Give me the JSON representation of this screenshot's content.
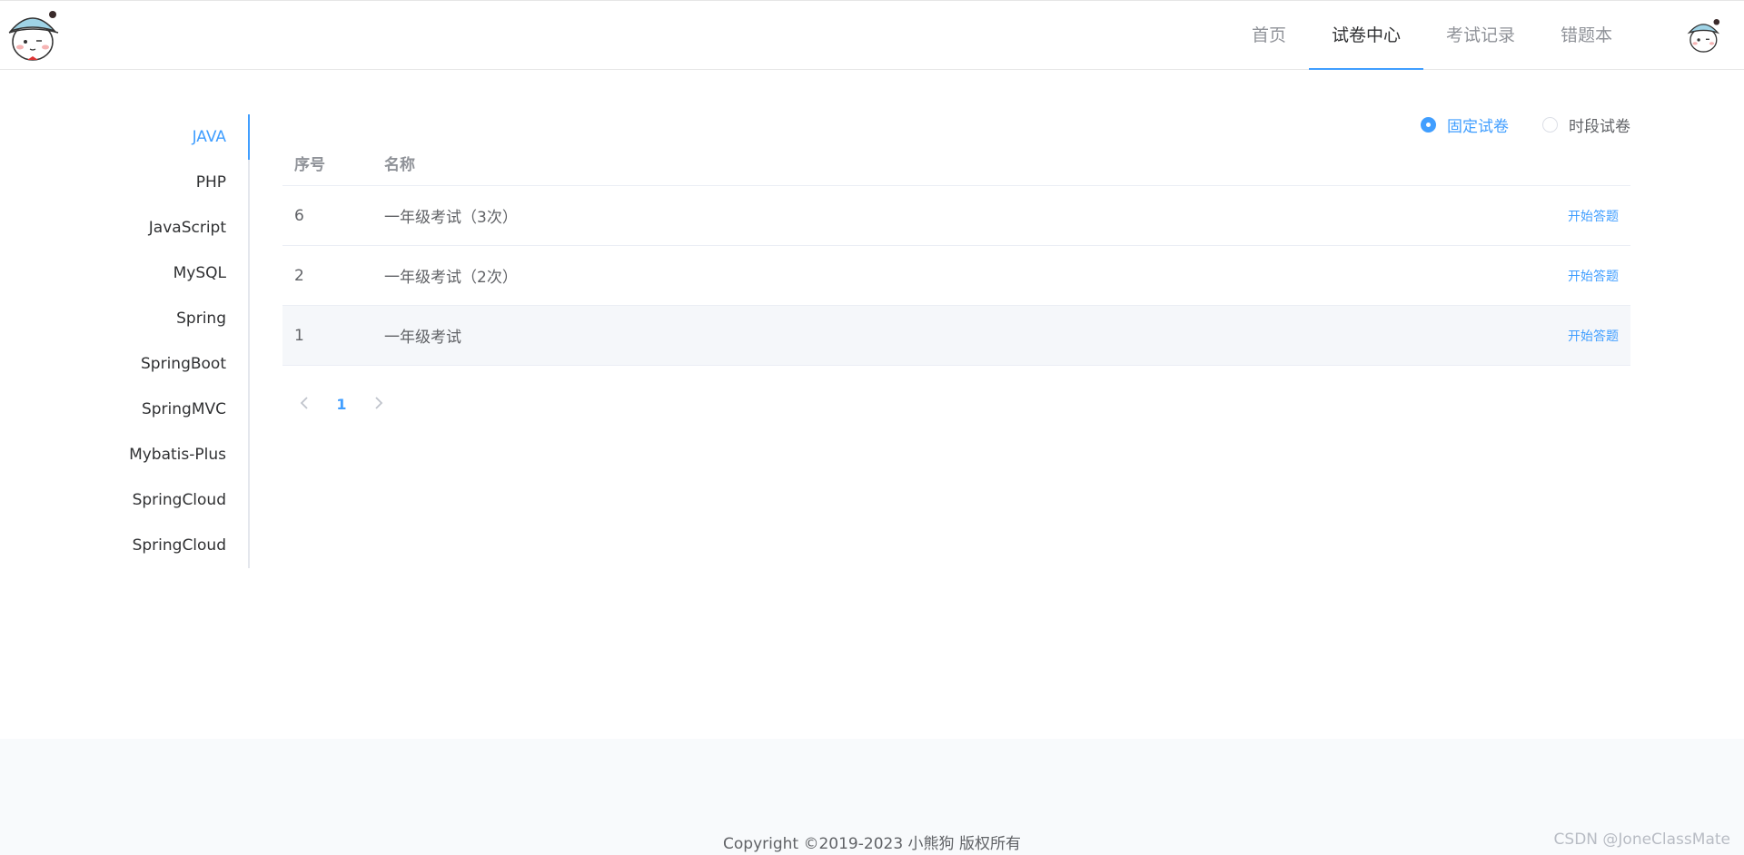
{
  "header": {
    "nav": [
      {
        "label": "首页",
        "active": false
      },
      {
        "label": "试卷中心",
        "active": true
      },
      {
        "label": "考试记录",
        "active": false
      },
      {
        "label": "错题本",
        "active": false
      }
    ]
  },
  "sidebar": {
    "items": [
      {
        "label": "JAVA",
        "active": true
      },
      {
        "label": "PHP"
      },
      {
        "label": "JavaScript"
      },
      {
        "label": "MySQL"
      },
      {
        "label": "Spring"
      },
      {
        "label": "SpringBoot"
      },
      {
        "label": "SpringMVC"
      },
      {
        "label": "Mybatis-Plus"
      },
      {
        "label": "SpringCloud"
      },
      {
        "label": "SpringCloud"
      }
    ]
  },
  "paper_type": {
    "options": [
      {
        "label": "固定试卷",
        "checked": true
      },
      {
        "label": "时段试卷",
        "checked": false
      }
    ]
  },
  "table": {
    "headers": {
      "no": "序号",
      "name": "名称"
    },
    "rows": [
      {
        "no": "6",
        "name": "一年级考试（3次）",
        "action": "开始答题"
      },
      {
        "no": "2",
        "name": "一年级考试（2次）",
        "action": "开始答题"
      },
      {
        "no": "1",
        "name": "一年级考试",
        "action": "开始答题"
      }
    ]
  },
  "pagination": {
    "prev_icon": "chevron-left-icon",
    "current_page": "1",
    "next_icon": "chevron-right-icon"
  },
  "footer": {
    "copyright": "Copyright ©2019-2023 小熊狗 版权所有",
    "watermark": "CSDN @JoneClassMate"
  },
  "colors": {
    "accent": "#409eff",
    "footer_bg": "#f8fafc"
  }
}
